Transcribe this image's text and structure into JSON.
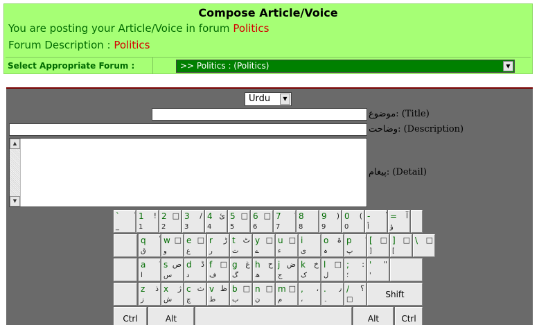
{
  "header": {
    "title": "Compose Article/Voice",
    "posting_prefix": "You are posting your Article/Voice in forum ",
    "forum_name": "Politics",
    "description_prefix": "Forum Description : ",
    "forum_description": "Politics",
    "select_label": "Select Appropriate Forum :",
    "selected_forum": ">> Politics : (Politics)"
  },
  "form": {
    "language": "Urdu",
    "title_label": "موضوع: (Title)",
    "description_label": "وضاحت: (Description)",
    "detail_label": "پیغام: (Detail)",
    "title_value": "",
    "description_value": "",
    "detail_value": ""
  },
  "keyboard": {
    "rows": [
      [
        {
          "en": "`",
          "ur": "ً",
          "sh": "_"
        },
        {
          "en": "1",
          "ur": "!",
          "sh": "1"
        },
        {
          "en": "2",
          "ur": "□",
          "sh": "2"
        },
        {
          "en": "3",
          "ur": "/",
          "sh": "3"
        },
        {
          "en": "4",
          "ur": "ئ",
          "sh": "4"
        },
        {
          "en": "5",
          "ur": "□",
          "sh": "5"
        },
        {
          "en": "6",
          "ur": "□",
          "sh": "6"
        },
        {
          "en": "7",
          "ur": "ٌ",
          "sh": "7"
        },
        {
          "en": "8",
          "ur": "ٰ",
          "sh": "8"
        },
        {
          "en": "9",
          "ur": ")",
          "sh": "9"
        },
        {
          "en": "0",
          "ur": "(",
          "sh": "0"
        },
        {
          "en": "-",
          "ur": "ٗ",
          "sh": "أ"
        },
        {
          "en": "=",
          "ur": "آ",
          "sh": "ؤ"
        }
      ],
      [
        {
          "en": "q",
          "ur": "ْ",
          "sh": "ق"
        },
        {
          "en": "w",
          "ur": "□",
          "sh": "و"
        },
        {
          "en": "e",
          "ur": "□",
          "sh": "ع"
        },
        {
          "en": "r",
          "ur": "ڑ",
          "sh": "ر"
        },
        {
          "en": "t",
          "ur": "ٹ",
          "sh": "ت"
        },
        {
          "en": "y",
          "ur": "□",
          "sh": "ے"
        },
        {
          "en": "u",
          "ur": "□",
          "sh": "ء"
        },
        {
          "en": "i",
          "ur": "ٰ",
          "sh": "ی"
        },
        {
          "en": "o",
          "ur": "ۃ",
          "sh": "ہ"
        },
        {
          "en": "p",
          "ur": "ُ",
          "sh": "پ"
        },
        {
          "en": "[",
          "ur": "□",
          "sh": "]"
        },
        {
          "en": "]",
          "ur": "□",
          "sh": "["
        },
        {
          "en": "\\",
          "ur": "□",
          "sh": ""
        }
      ],
      [
        {
          "en": "a",
          "ur": "ٓ",
          "sh": "ا"
        },
        {
          "en": "s",
          "ur": "ص",
          "sh": "س"
        },
        {
          "en": "d",
          "ur": "ڈ",
          "sh": "د"
        },
        {
          "en": "f",
          "ur": "□",
          "sh": "ف"
        },
        {
          "en": "g",
          "ur": "غ",
          "sh": "گ"
        },
        {
          "en": "h",
          "ur": "ح",
          "sh": "ھ"
        },
        {
          "en": "j",
          "ur": "ض",
          "sh": "ج"
        },
        {
          "en": "k",
          "ur": "خ",
          "sh": "ک"
        },
        {
          "en": "l",
          "ur": "□",
          "sh": "ل"
        },
        {
          "en": ";",
          "ur": ":",
          "sh": "؛"
        },
        {
          "en": "'",
          "ur": "\"",
          "sh": "'"
        }
      ],
      [
        {
          "en": "z",
          "ur": "ذ",
          "sh": "ز"
        },
        {
          "en": "x",
          "ur": "ژ",
          "sh": "ش"
        },
        {
          "en": "c",
          "ur": "ث",
          "sh": "چ"
        },
        {
          "en": "v",
          "ur": "ظ",
          "sh": "ط"
        },
        {
          "en": "b",
          "ur": "□",
          "sh": "ب"
        },
        {
          "en": "n",
          "ur": "□",
          "sh": "ن"
        },
        {
          "en": "m",
          "ur": "□",
          "sh": "م"
        },
        {
          "en": ",",
          "ur": "،",
          "sh": "،"
        },
        {
          "en": ".",
          "ur": "٫",
          "sh": "۔"
        },
        {
          "en": "/",
          "ur": "؟",
          "sh": "□"
        }
      ]
    ],
    "shift_label": "Shift",
    "ctrl_label": "Ctrl",
    "alt_label": "Alt"
  }
}
